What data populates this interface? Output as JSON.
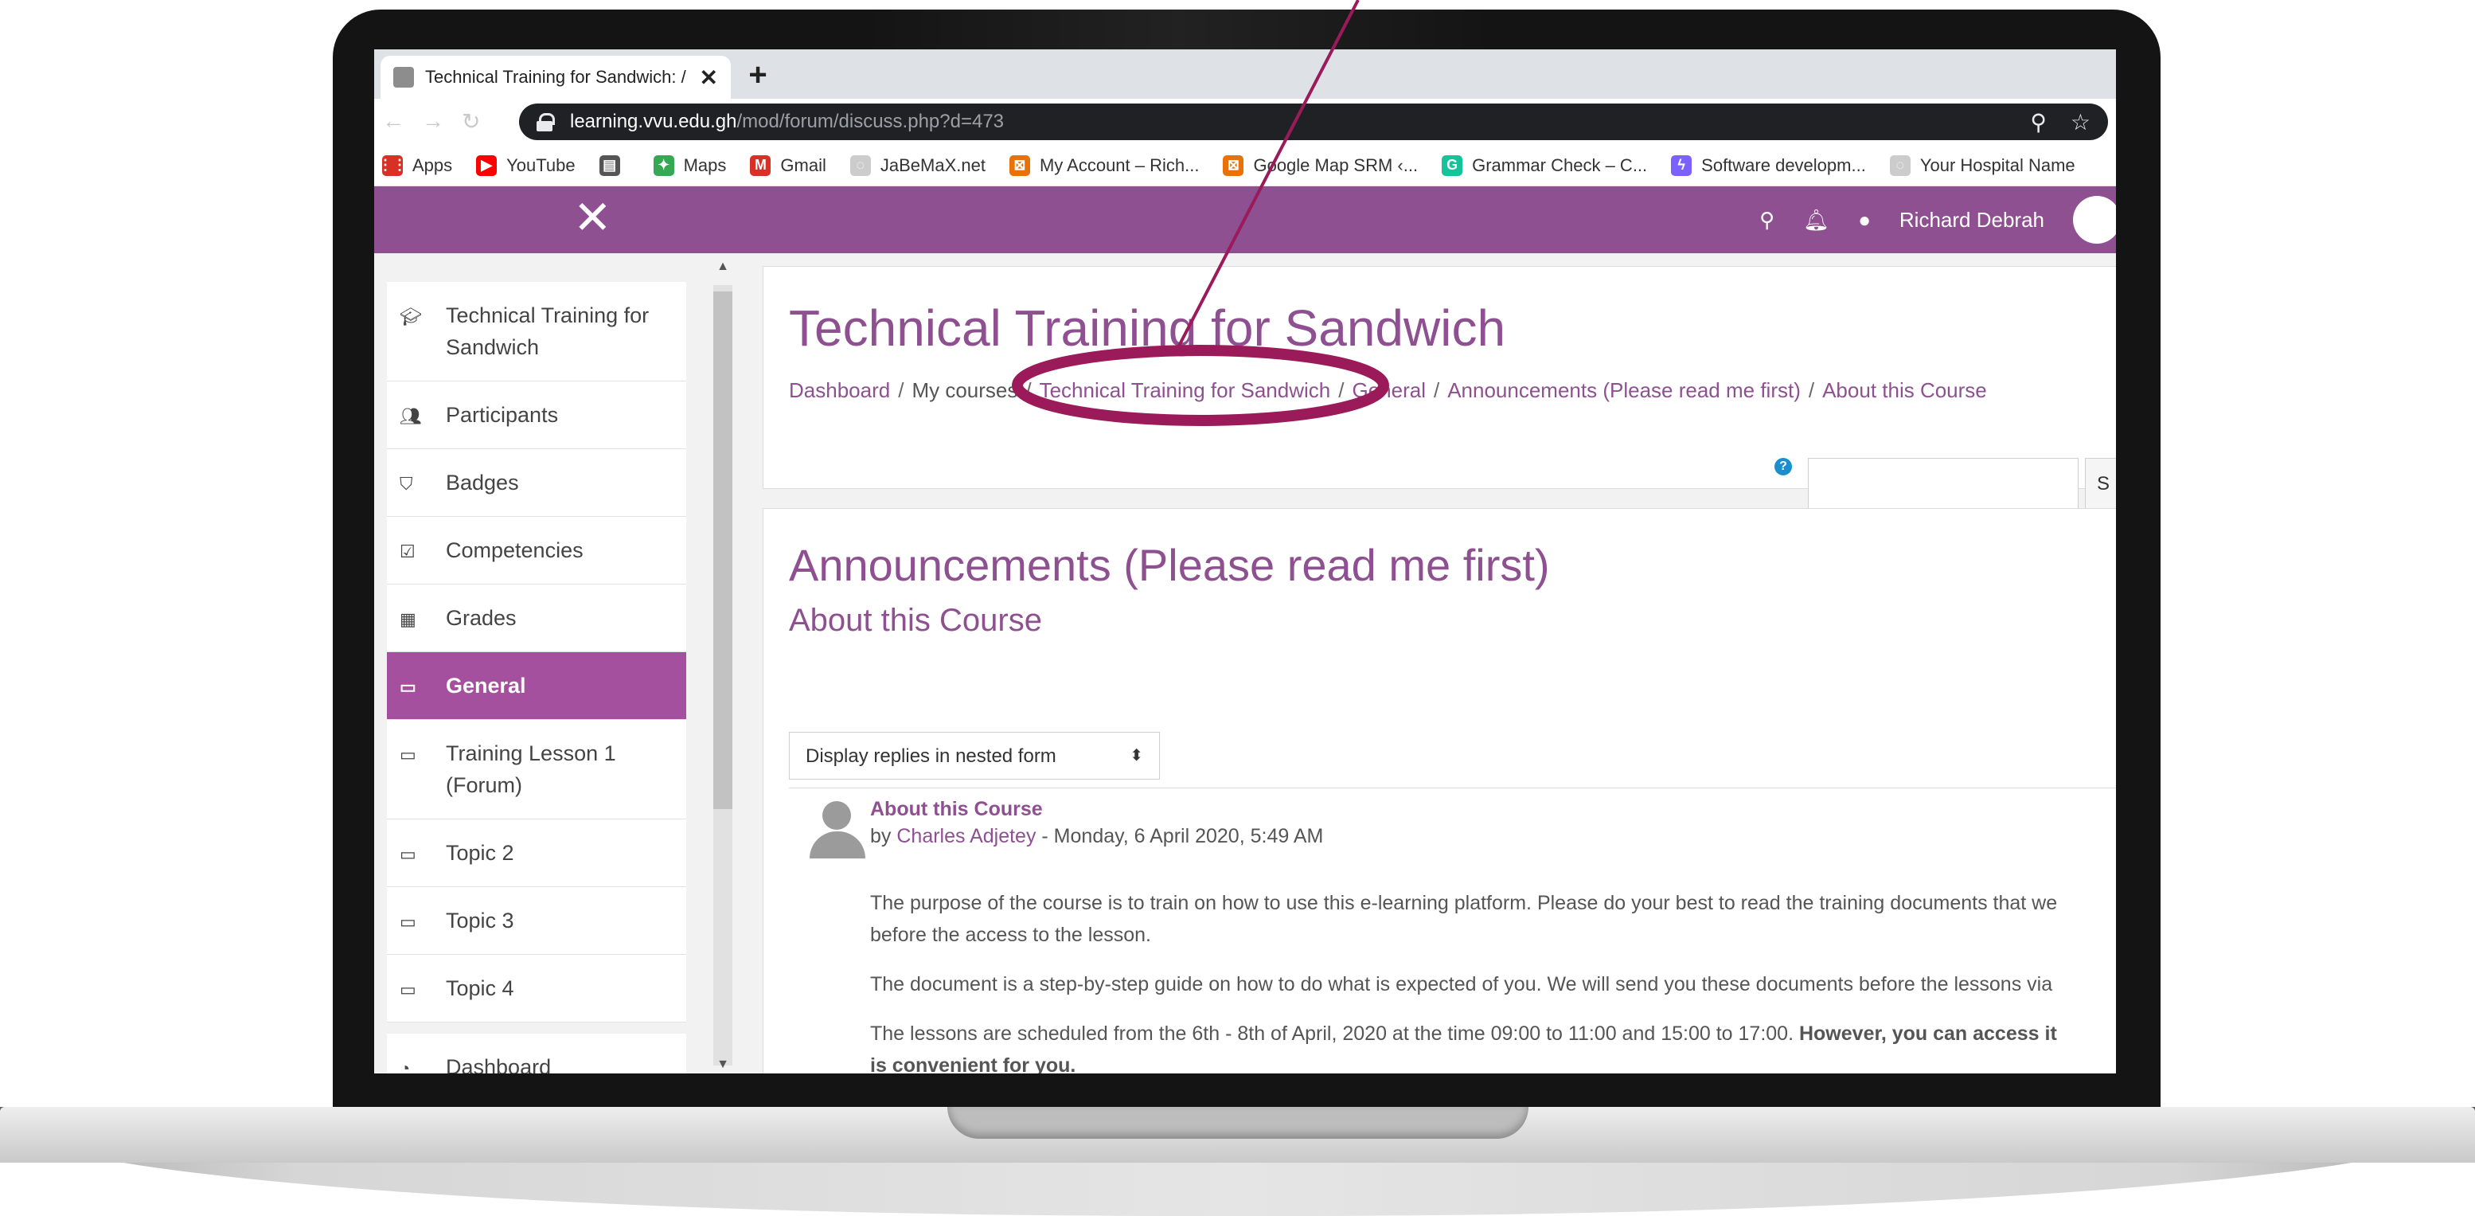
{
  "browser": {
    "tab_title": "Technical Training for Sandwich: /",
    "url_host": "learning.vvu.edu.gh",
    "url_path": "/mod/forum/discuss.php?d=473",
    "bookmarks": [
      {
        "label": "Apps",
        "icon": "apps-grid-icon",
        "color": "#d93025"
      },
      {
        "label": "YouTube",
        "icon": "youtube-icon",
        "color": "#ff0000"
      },
      {
        "label": "",
        "icon": "bookmark-site-icon",
        "color": "#555555"
      },
      {
        "label": "Maps",
        "icon": "maps-icon",
        "color": "#34a853"
      },
      {
        "label": "Gmail",
        "icon": "gmail-icon",
        "color": "#d93025"
      },
      {
        "label": "JaBeMaX.net",
        "icon": "globe-icon",
        "color": "#cccccc"
      },
      {
        "label": "My Account – Rich...",
        "icon": "office-icon",
        "color": "#e8710a"
      },
      {
        "label": "Google Map SRM ‹...",
        "icon": "office-icon",
        "color": "#e8710a"
      },
      {
        "label": "Grammar Check – C...",
        "icon": "grammarly-icon",
        "color": "#15c39a"
      },
      {
        "label": "Software developm...",
        "icon": "lightning-icon",
        "color": "#7b61ff"
      },
      {
        "label": "Your Hospital Name",
        "icon": "globe-icon",
        "color": "#cccccc"
      }
    ]
  },
  "topbar": {
    "user_name": "Richard Debrah",
    "brand_color": "#8e5090"
  },
  "drawer": {
    "items": [
      {
        "label": "Technical Training for Sandwich",
        "icon": "graduation-cap-icon"
      },
      {
        "label": "Participants",
        "icon": "users-icon"
      },
      {
        "label": "Badges",
        "icon": "shield-icon"
      },
      {
        "label": "Competencies",
        "icon": "checkbox-icon"
      },
      {
        "label": "Grades",
        "icon": "table-icon"
      },
      {
        "label": "General",
        "icon": "folder-icon"
      },
      {
        "label": "Training Lesson 1 (Forum)",
        "icon": "folder-icon"
      },
      {
        "label": "Topic 2",
        "icon": "folder-icon"
      },
      {
        "label": "Topic 3",
        "icon": "folder-icon"
      },
      {
        "label": "Topic 4",
        "icon": "folder-icon"
      },
      {
        "label": "Dashboard",
        "icon": "dashboard-icon"
      }
    ]
  },
  "header": {
    "course_title": "Technical Training for Sandwich",
    "breadcrumb": [
      "Dashboard",
      "My courses",
      "Technical Training for Sandwich",
      "General",
      "Announcements (Please read me first)",
      "About this Course"
    ],
    "search_button": "S"
  },
  "forum": {
    "title": "Announcements (Please read me first)",
    "discussion_title": "About this Course",
    "display_mode": "Display replies in nested form",
    "post": {
      "subject": "About this Course",
      "by": "by",
      "author": "Charles Adjetey",
      "date": " - Monday, 6 April 2020, 5:49 AM",
      "paragraphs": [
        "The purpose of the course is to train on how to use this e-learning platform. Please do your best to read the training documents that we",
        "before the access to the lesson.",
        "The document is a step-by-step guide on how to do what is expected of you. We will send you these documents before the lessons via",
        "The lessons are scheduled from the 6th - 8th of April, 2020 at the time 09:00 to 11:00 and 15:00 to 17:00.",
        "However, you can access it",
        "is convenient for you."
      ]
    }
  },
  "annotation": {
    "color": "#9b1b5a"
  }
}
